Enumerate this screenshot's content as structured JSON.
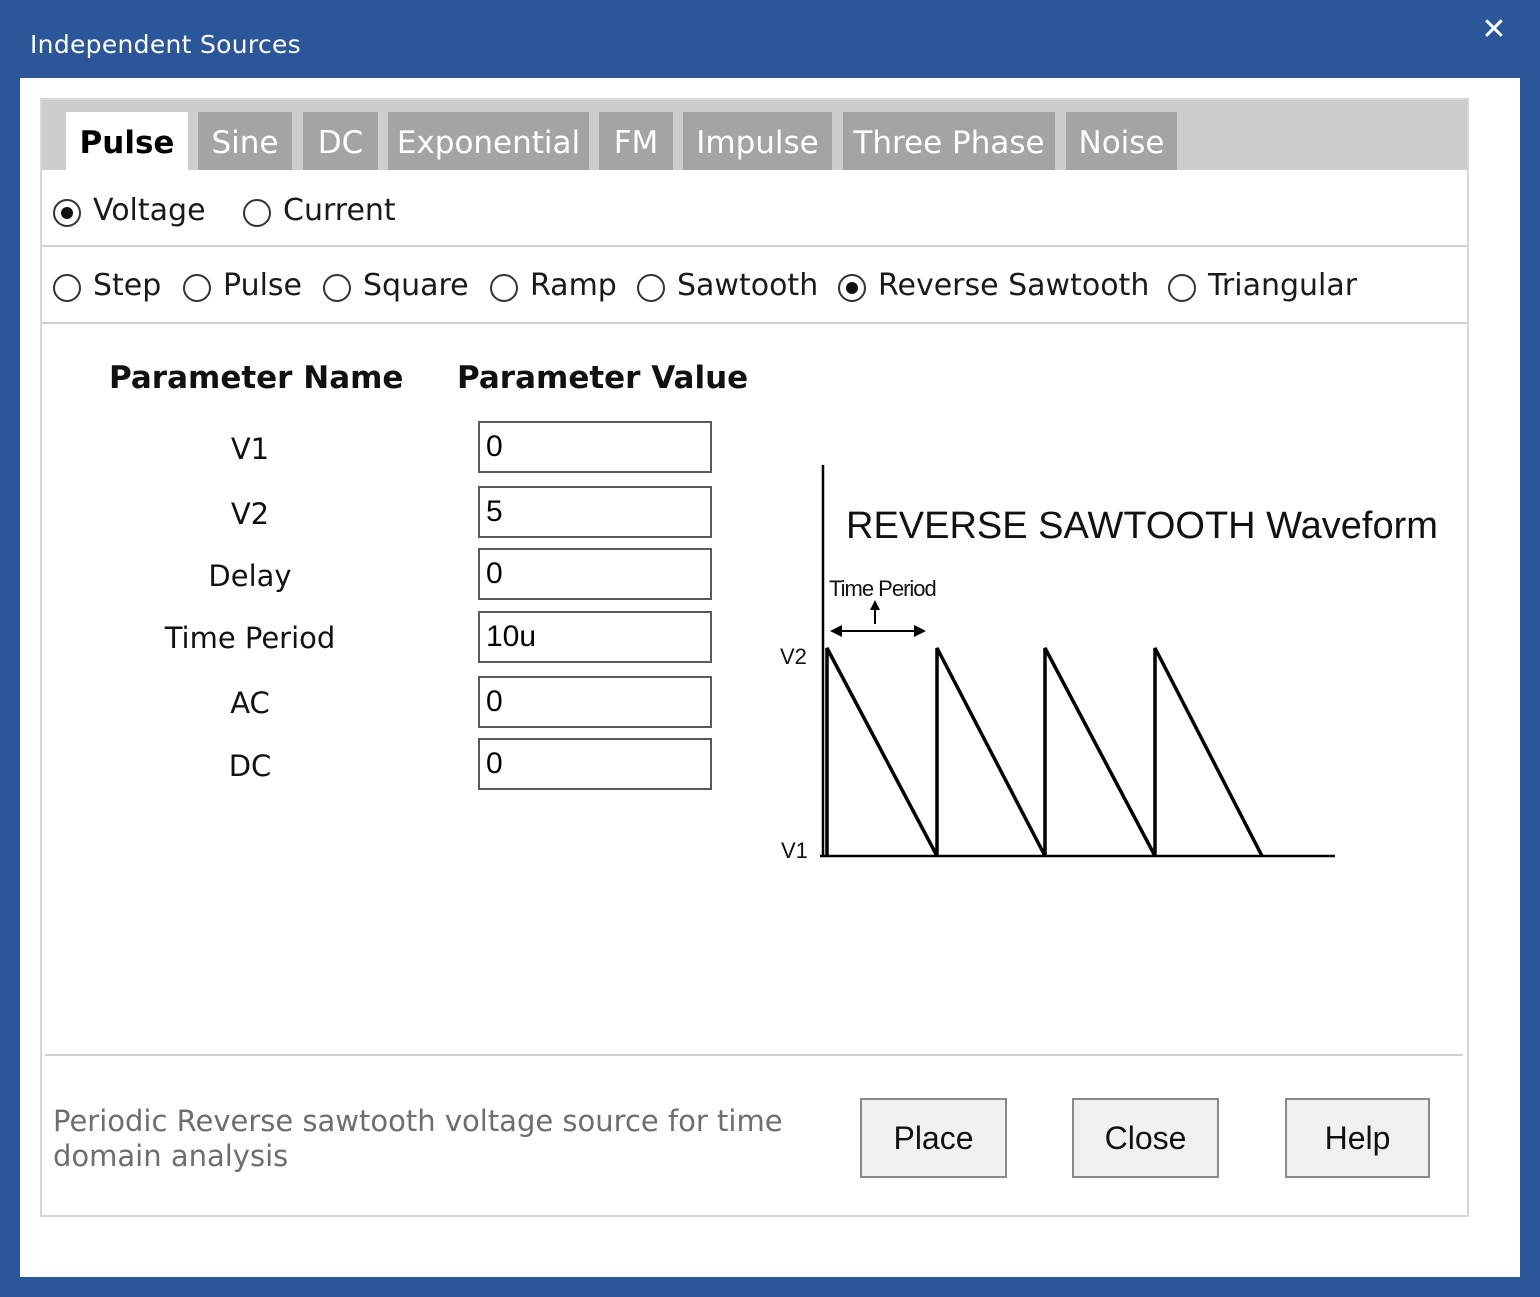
{
  "window": {
    "title": "Independent Sources",
    "close_glyph": "✕"
  },
  "tabs": [
    {
      "label": "Pulse",
      "active": true
    },
    {
      "label": "Sine"
    },
    {
      "label": "DC"
    },
    {
      "label": "Exponential"
    },
    {
      "label": "FM"
    },
    {
      "label": "Impulse"
    },
    {
      "label": "Three Phase"
    },
    {
      "label": "Noise"
    }
  ],
  "source_kind": {
    "voltage": "Voltage",
    "current": "Current",
    "selected": "voltage"
  },
  "waveform_types": {
    "options": [
      "Step",
      "Pulse",
      "Square",
      "Ramp",
      "Sawtooth",
      "Reverse Sawtooth",
      "Triangular"
    ],
    "selected": "Reverse Sawtooth"
  },
  "params": {
    "header_name": "Parameter Name",
    "header_value": "Parameter Value",
    "rows": [
      {
        "name": "V1",
        "value": "0"
      },
      {
        "name": "V2",
        "value": "5"
      },
      {
        "name": "Delay",
        "value": "0"
      },
      {
        "name": "Time Period",
        "value": "10u"
      },
      {
        "name": "AC",
        "value": "0"
      },
      {
        "name": "DC",
        "value": "0"
      }
    ]
  },
  "diagram": {
    "title": "REVERSE SAWTOOTH Waveform",
    "period_label": "Time Period",
    "v2_label": "V2",
    "v1_label": "V1"
  },
  "description": "Periodic Reverse sawtooth voltage source for time domain analysis",
  "buttons": {
    "place": "Place",
    "close": "Close",
    "help": "Help"
  }
}
